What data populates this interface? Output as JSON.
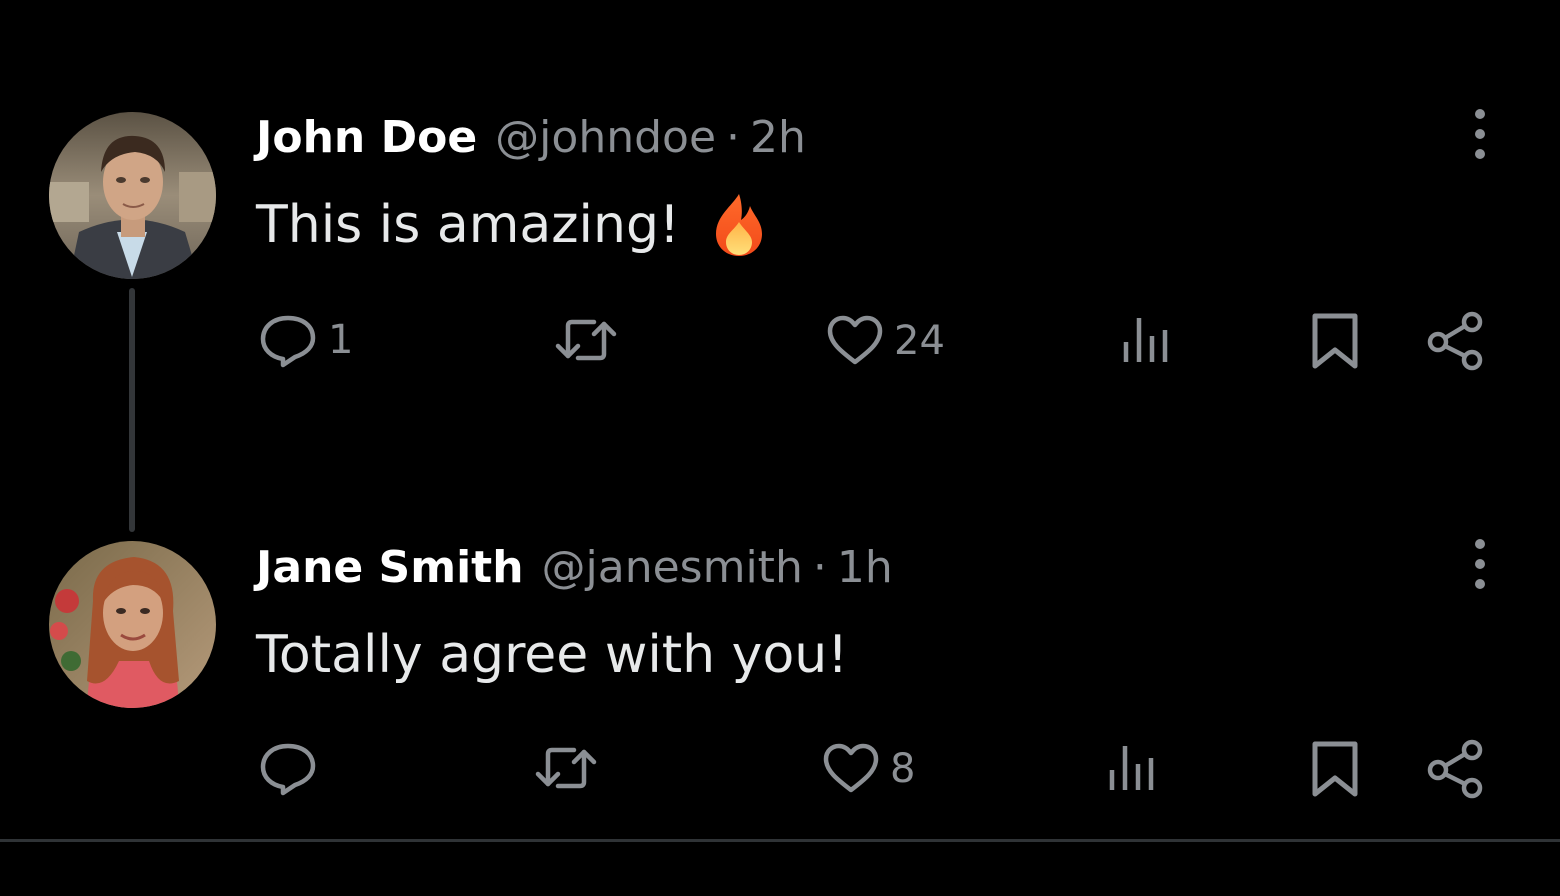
{
  "tweets": [
    {
      "author": "John Doe",
      "handle": "@johndoe",
      "separator": "·",
      "time": "2h",
      "text": "This is amazing!",
      "emoji": "fire-icon",
      "actions": {
        "reply": "1",
        "retweet": "",
        "like": "24",
        "views": "",
        "bookmark": "",
        "share": ""
      }
    },
    {
      "author": "Jane Smith",
      "handle": "@janesmith",
      "separator": "·",
      "time": "1h",
      "text": "Totally agree with you!",
      "actions": {
        "reply": "",
        "retweet": "",
        "like": "8",
        "views": "",
        "bookmark": "",
        "share": ""
      }
    }
  ],
  "colors": {
    "background": "#000000",
    "name": "#ffffff",
    "text": "#e7e9ea",
    "secondary": "#8b8f94",
    "thread_line": "#333639",
    "divider": "#2f3336"
  }
}
